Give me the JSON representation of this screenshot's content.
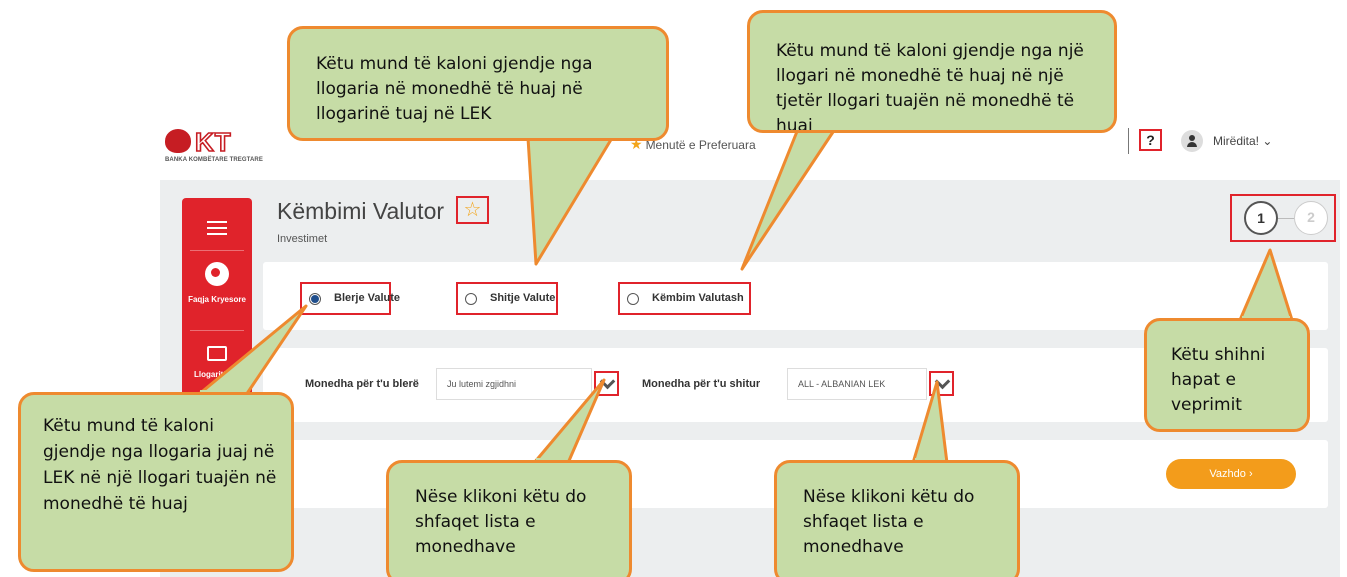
{
  "header": {
    "bank_name": "BANKA KOMBËTARE TREGTARE",
    "favorites": "Menutë e Preferuara",
    "help_label": "?",
    "greeting": "Mirëdita!",
    "greeting_chevron": "chevron-down-icon"
  },
  "sidebar": {
    "home_label": "Faqja Kryesore",
    "accounts_label": "Llogaritë"
  },
  "page": {
    "title": "Këmbimi Valutor",
    "title_star": "☆",
    "subtitle": "Investimet"
  },
  "steps": [
    "1",
    "2"
  ],
  "exchange_types": [
    {
      "label": "Blerje Valute",
      "selected": true
    },
    {
      "label": "Shitje Valute",
      "selected": false
    },
    {
      "label": "Këmbim Valutash",
      "selected": false
    }
  ],
  "form": {
    "buy_label": "Monedha për t'u blerë",
    "buy_value": "Ju lutemi zgjidhni",
    "sell_label": "Monedha për t'u shitur",
    "sell_value": "ALL - ALBANIAN LEK"
  },
  "continue_label": "Vazhdo ›",
  "colors": {
    "brand_red": "#e0232b",
    "accent_orange": "#f39c1b",
    "callout_fill": "#c6dca6",
    "callout_border": "#ee8a2f"
  },
  "callouts": {
    "buy_sell_lek": "Këtu mund të kaloni gjendje nga llogaria në monedhë të huaj në llogarinë tuaj në LEK",
    "exchange": "Këtu mund të kaloni gjendje nga një llogari në monedhë të huaj në një tjetër llogari tuajën në monedhë të huaj",
    "steps": "Këtu shihni hapat e veprimit",
    "buy": "Këtu mund të kaloni gjendje nga llogaria juaj në LEK në një llogari tuajën në monedhë të huaj",
    "dropdown1": "Nëse klikoni këtu do shfaqet lista e monedhave",
    "dropdown2": "Nëse klikoni këtu do shfaqet lista e monedhave"
  }
}
